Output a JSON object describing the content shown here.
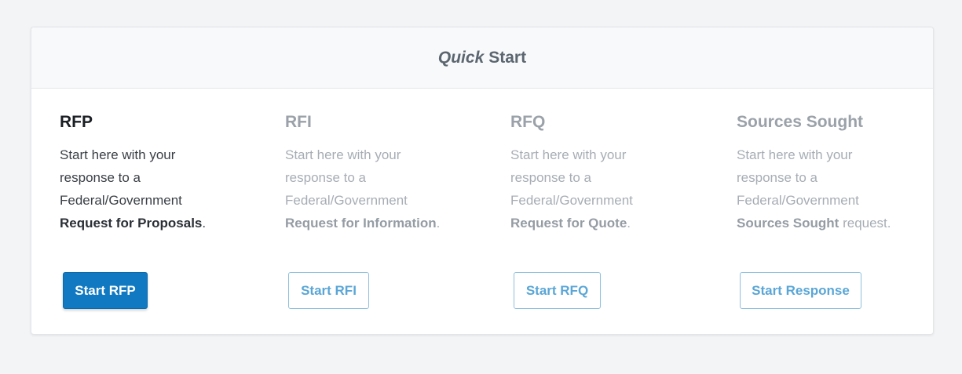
{
  "header": {
    "title_italic": "Quick",
    "title_rest": "Start"
  },
  "options": [
    {
      "title": "RFP",
      "text_lines": [
        "Start here with your",
        "response to a",
        "Federal/Government"
      ],
      "bold": "Request for Proposals",
      "suffix": ".",
      "button": "Start RFP"
    },
    {
      "title": "RFI",
      "text_lines": [
        "Start here with your",
        "response to a",
        "Federal/Government"
      ],
      "bold": "Request for Information",
      "suffix": ".",
      "button": "Start RFI"
    },
    {
      "title": "RFQ",
      "text_lines": [
        "Start here with your",
        "response to a",
        "Federal/Government"
      ],
      "bold": "Request for Quote",
      "suffix": ".",
      "button": "Start RFQ"
    },
    {
      "title": "Sources Sought",
      "text_lines": [
        "Start here with your",
        "response to a",
        "Federal/Government"
      ],
      "bold": "Sources Sought",
      "suffix": " request.",
      "button": "Start Response"
    }
  ],
  "colors": {
    "primary": "#1079c2",
    "outline": "#5aa6d6",
    "muted_text": "#a7adb4"
  }
}
